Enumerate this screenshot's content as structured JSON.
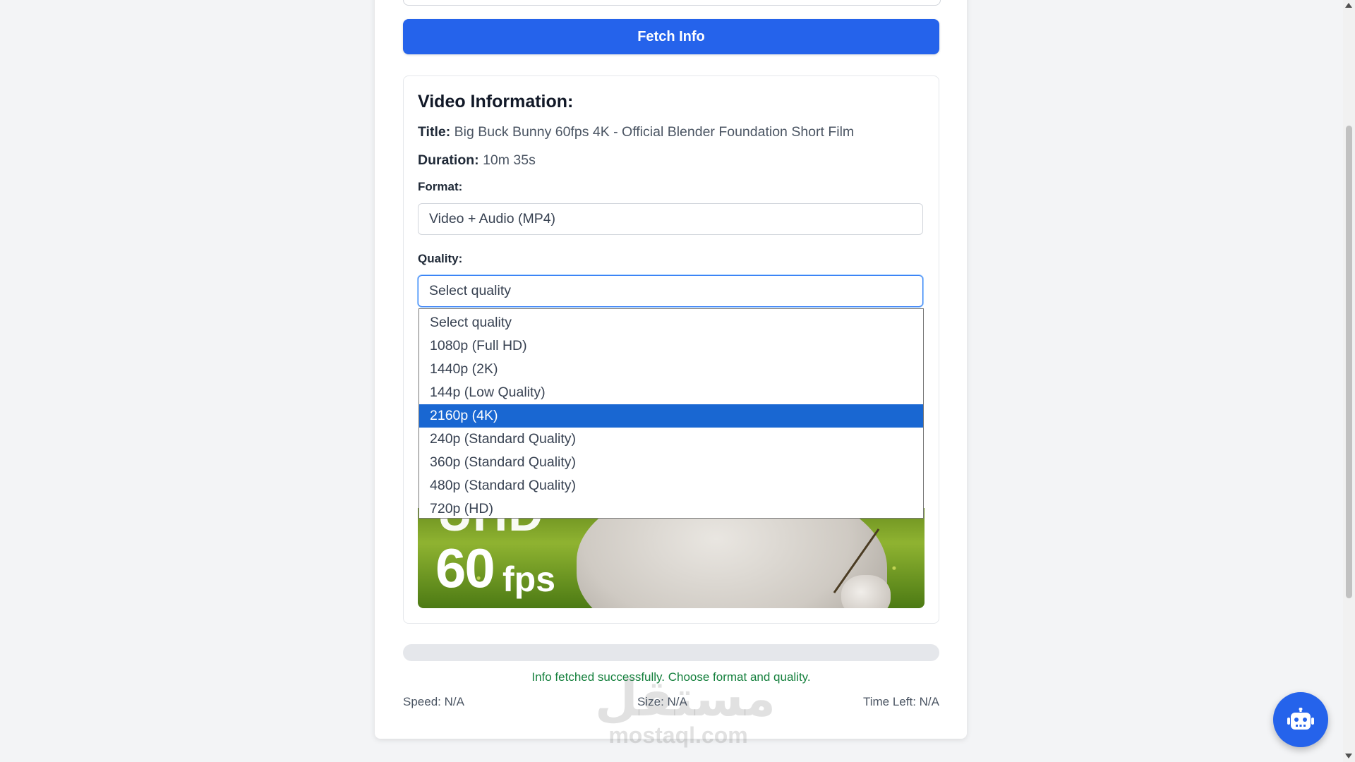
{
  "actions": {
    "fetch_label": "Fetch Info"
  },
  "video_info": {
    "heading": "Video Information:",
    "title_label": "Title:",
    "title_value": "Big Buck Bunny 60fps 4K - Official Blender Foundation Short Film",
    "duration_label": "Duration:",
    "duration_value": "10m 35s"
  },
  "format": {
    "label": "Format:",
    "selected": "Video + Audio (MP4)"
  },
  "quality": {
    "label": "Quality:",
    "selected": "Select quality",
    "options": [
      "Select quality",
      "1080p (Full HD)",
      "1440p (2K)",
      "144p (Low Quality)",
      "2160p (4K)",
      "240p (Standard Quality)",
      "360p (Standard Quality)",
      "480p (Standard Quality)",
      "720p (HD)"
    ],
    "highlighted_index": 4
  },
  "thumbnail": {
    "line1": "UHD",
    "line2_number": "60",
    "line2_unit": "fps"
  },
  "progress": {
    "percent": 0
  },
  "status": {
    "message": "Info fetched successfully. Choose format and quality.",
    "speed": "Speed: N/A",
    "size": "Size: N/A",
    "time_left": "Time Left: N/A"
  },
  "watermark": {
    "arabic": "مستقل",
    "latin": "mostaql.com"
  },
  "icons": {
    "chat": "robot-icon"
  },
  "colors": {
    "primary": "#2563eb",
    "success": "#15803d",
    "highlight": "#1967d2"
  }
}
